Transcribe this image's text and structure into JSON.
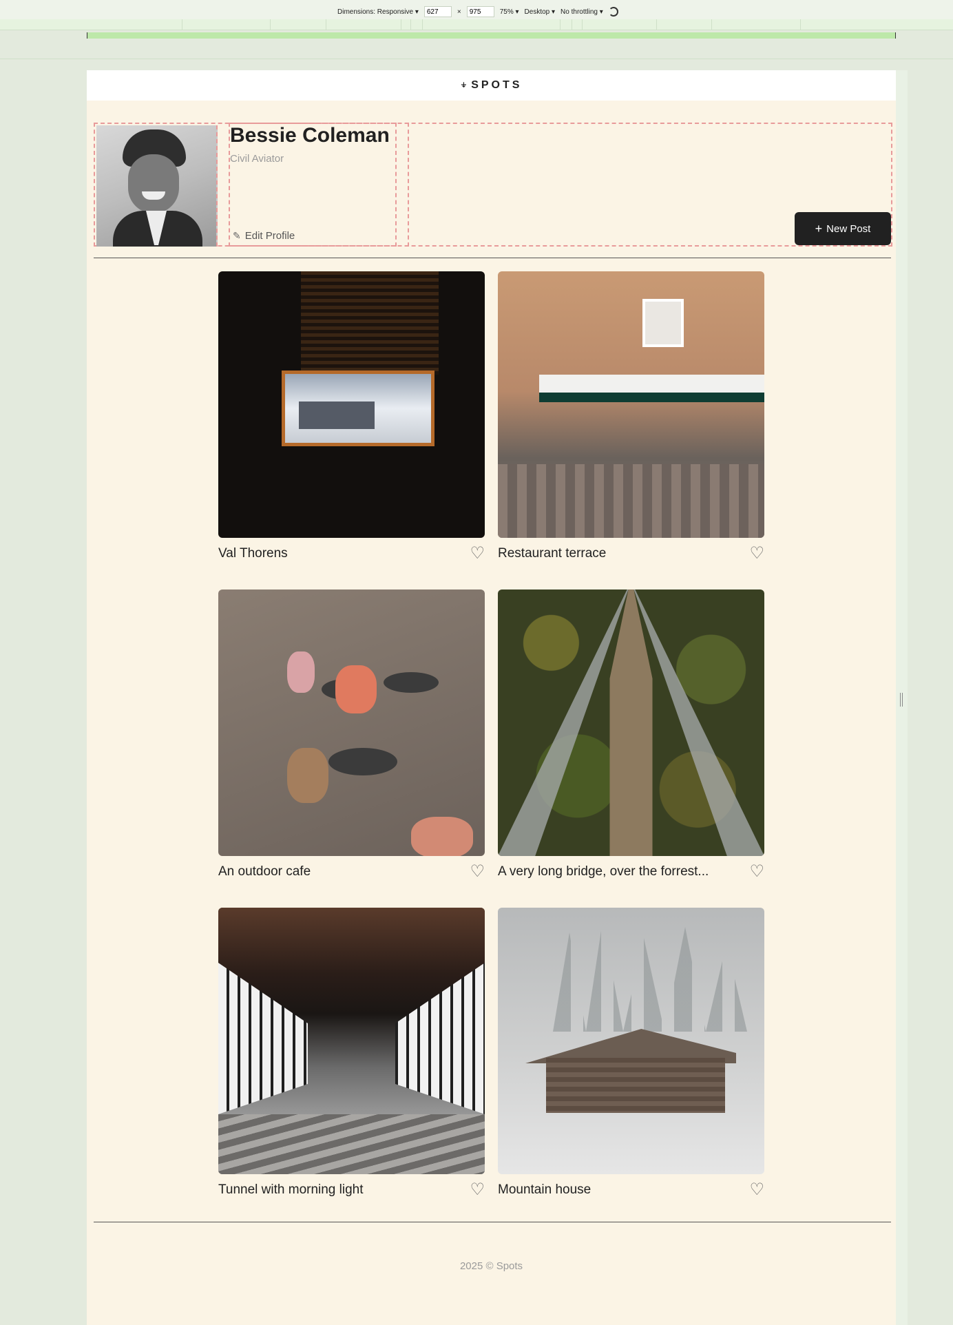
{
  "devtools": {
    "dimensions_label": "Dimensions: Responsive",
    "width": "627",
    "times": "×",
    "height": "975",
    "zoom": "75%",
    "device": "Desktop",
    "throttling": "No throttling"
  },
  "header": {
    "logo_mark": "⍖",
    "logo_text": "SPOTS"
  },
  "profile": {
    "name": "Bessie Coleman",
    "role": "Civil Aviator",
    "edit_label": "Edit Profile",
    "new_post_label": "New Post",
    "plus": "+"
  },
  "cards": [
    {
      "title": "Val Thorens"
    },
    {
      "title": "Restaurant terrace"
    },
    {
      "title": "An outdoor cafe"
    },
    {
      "title": "A very long bridge, over the forrest..."
    },
    {
      "title": "Tunnel with morning light"
    },
    {
      "title": "Mountain house"
    }
  ],
  "footer": {
    "text": "2025 © Spots"
  }
}
